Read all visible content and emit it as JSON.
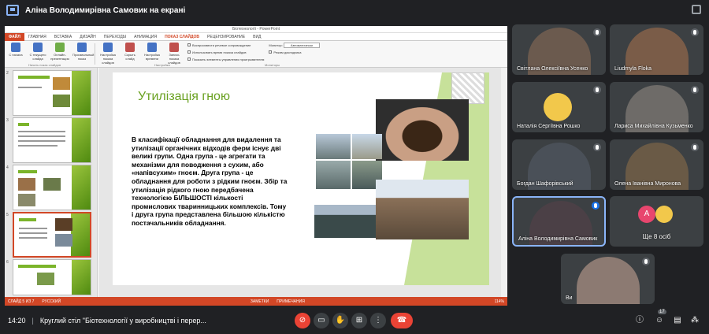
{
  "top": {
    "presenter_text": "Аліна Володимирівна Самовик на екрані"
  },
  "ppt": {
    "window_title": "Біотехнології - PowerPoint",
    "tabs": [
      "ФАЙЛ",
      "ГЛАВНАЯ",
      "ВСТАВКА",
      "ДИЗАЙН",
      "ПЕРЕХОДЫ",
      "АНИМАЦИЯ",
      "ПОКАЗ СЛАЙДОВ",
      "РЕЦЕНЗИРОВАНИЕ",
      "ВИД"
    ],
    "ribbon": {
      "buttons": [
        "С начала",
        "С текущего слайда",
        "Онлайн-презентация",
        "Произвольный показ",
        "Настройка показа слайдов",
        "Скрыть слайд",
        "Настройка времени",
        "Запись показа слайдов"
      ],
      "checks": [
        "Воспроизвести речевое сопровождение",
        "Использовать время показа слайдов",
        "Показать элементы управления проигрывателем"
      ],
      "monitor_label": "Монитор:",
      "monitor_value": "Автоматически",
      "presenter_view": "Режим докладчика",
      "groups": [
        "Начать показ слайдов",
        "Настройка",
        "Мониторы"
      ]
    },
    "thumbs": [
      "2",
      "3",
      "4",
      "5",
      "6"
    ],
    "slide": {
      "title": "Утилізація гною",
      "body": "В класифікації обладнання для видалення та утилізації органічних відходів ферм існує дві великі групи. Одна група - це агрегати та механізми для поводження з сухим, або «напівсухим» гноєм. Друга група - це обладнання для роботи з рідким гноєм. Збір та утилізація рідкого гною передбачена технологією БІЛЬШОСТІ кількості промислових тваринницьких комплексів. Тому і друга група представлена більшою кількістю постачальників обладнання."
    },
    "status": {
      "slide": "СЛАЙД 5 ИЗ 7",
      "lang": "РУССКИЙ",
      "notes": "ЗАМЕТКИ",
      "comments": "ПРИМЕЧАНИЯ",
      "zoom": "114%"
    }
  },
  "participants": [
    {
      "name": "Світлана Олексіївна Усенко",
      "color": "#6b5a4e"
    },
    {
      "name": "Liudmyla Floka",
      "color": "#7a5c48"
    },
    {
      "name": "Наталія Сергіївна Рошко",
      "color": "#3c4043"
    },
    {
      "name": "Лариса Михайлівна Кузьменко",
      "color": "#6e6b68"
    },
    {
      "name": "Богдан Шафорівський",
      "color": "#4a5058"
    },
    {
      "name": "Олена Іванівна Миронова",
      "color": "#6a5a46"
    },
    {
      "name": "Аліна Володимирівна Самовик",
      "color": "#4b4046"
    },
    {
      "name": "Ще 8 осіб",
      "color": "#3c4043"
    },
    {
      "name": "Ви",
      "color": "#8c7a72"
    }
  ],
  "more": {
    "avatar_letter": "A"
  },
  "bottom": {
    "time": "14:20",
    "separator": "|",
    "meeting": "Круглий стіл \"Біотехнології у виробництві і перер...",
    "badge": "17"
  }
}
